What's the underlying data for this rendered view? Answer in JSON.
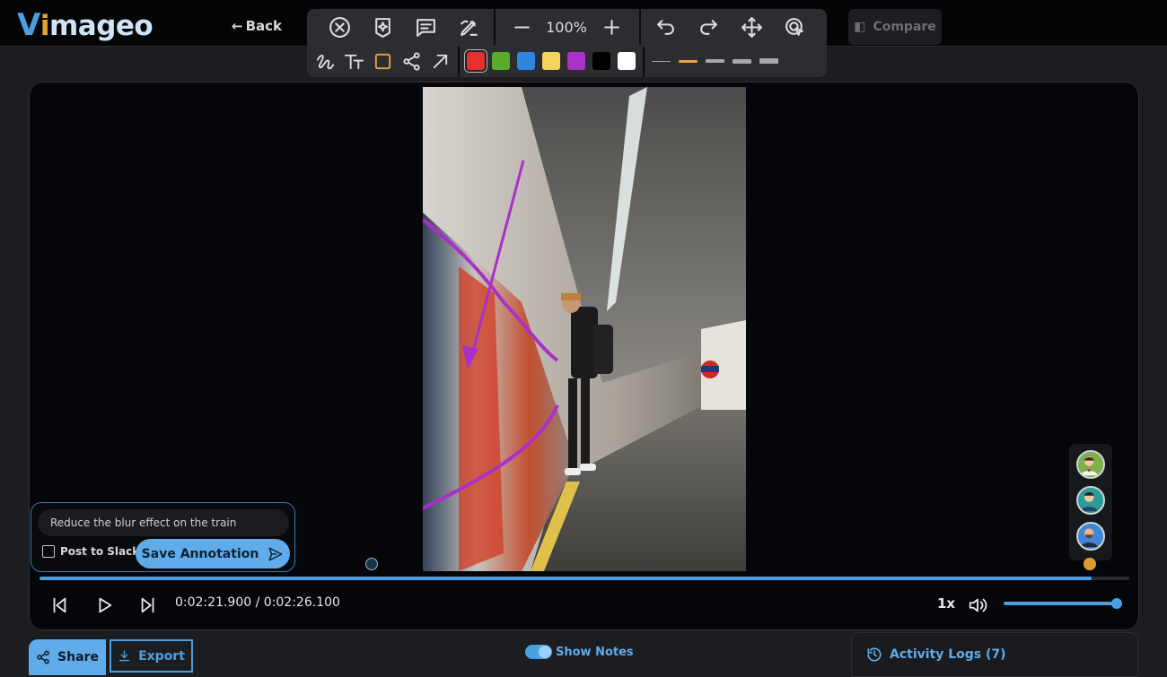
{
  "app": {
    "logo_v": "V",
    "logo_i": "i",
    "logo_rest": "mageo",
    "back_label": "Back"
  },
  "toolbar": {
    "zoom_level": "100%",
    "tools_row1": [
      "cancel-icon",
      "ai-sparkle-icon",
      "comment-icon",
      "pen-edit-icon"
    ],
    "history": [
      "undo-icon",
      "redo-icon",
      "move-icon",
      "select-pointer-icon"
    ],
    "tools_row2": [
      "freehand-icon",
      "text-icon",
      "rectangle-icon",
      "connector-icon",
      "arrow-icon"
    ],
    "colors": [
      "#e5312b",
      "#5aaa2c",
      "#2f86e0",
      "#f4d35e",
      "#a930c9",
      "#000000",
      "#ffffff"
    ],
    "selected_color": "#e5312b",
    "stroke_widths": [
      1,
      2,
      3,
      4,
      5
    ],
    "selected_stroke": 2,
    "selected_stroke_color": "#e8a33a"
  },
  "compare": {
    "label": "Compare"
  },
  "annotation": {
    "text": "Reduce the blur effect on the train",
    "post_to_slack": "Post to Slack",
    "save_label": "Save Annotation"
  },
  "player": {
    "current_time": "0:02:21.900",
    "total_time": "0:02:26.100",
    "time_display": "0:02:21.900 / 0:02:26.100",
    "progress": 0.965,
    "speed": "1x",
    "volume": 1.0
  },
  "reviewers": [
    "reviewer-1",
    "reviewer-2",
    "reviewer-3"
  ],
  "bottom": {
    "share_label": "Share",
    "export_label": "Export",
    "show_notes_label": "Show Notes",
    "activity_label": "Activity Logs (7)"
  },
  "colors": {
    "accent": "#4b9fe1",
    "accent_light": "#60abe9",
    "orange": "#e8a33a",
    "annotation_purple": "#a930c9"
  }
}
